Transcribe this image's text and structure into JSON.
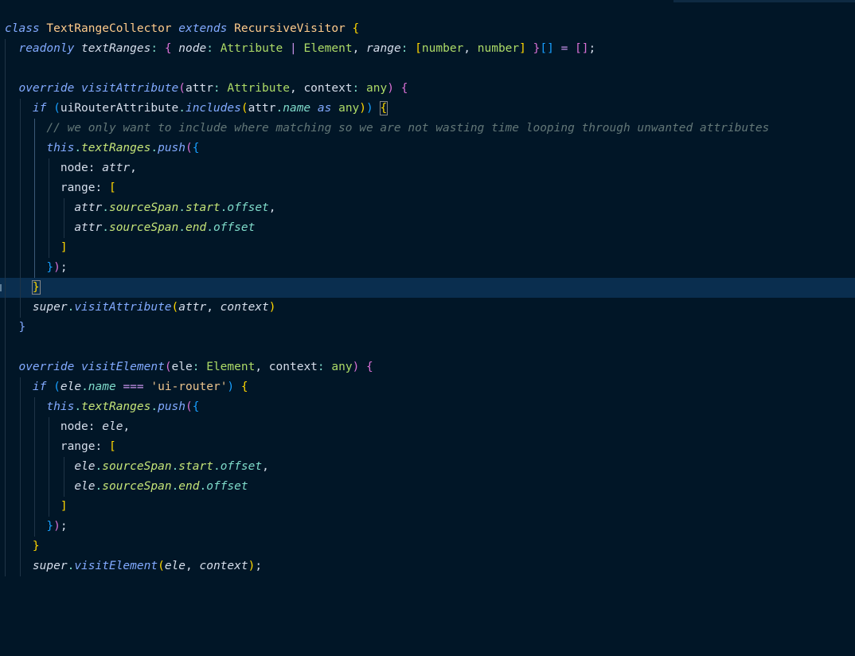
{
  "editor": {
    "language": "TypeScript",
    "theme_colors": {
      "background": "#011627",
      "current_line": "#0a2e4f",
      "keyword": "#82aaff",
      "class_name": "#c792ea",
      "type": "#addb67",
      "string": "#ecc48d",
      "comment": "#637777",
      "bracket_gold": "#ffd700",
      "bracket_orchid": "#da70d6",
      "bracket_blue": "#179fff"
    },
    "tokens": {
      "l1": [
        "class",
        "TextRangeCollector",
        "extends",
        "RecursiveVisitor",
        "{"
      ],
      "l2": [
        "readonly",
        "textRanges",
        ":",
        "{",
        "node",
        ":",
        "Attribute",
        "|",
        "Element",
        ",",
        "range",
        ":",
        "[",
        "number",
        ",",
        "number",
        "]",
        "}",
        "[]",
        "=",
        "[]",
        ";"
      ],
      "l4": [
        "override",
        "visitAttribute",
        "(",
        "attr",
        ":",
        "Attribute",
        ",",
        "context",
        ":",
        "any",
        ")",
        "{"
      ],
      "l5": [
        "if",
        "(",
        "uiRouterAttribute",
        ".",
        "includes",
        "(",
        "attr",
        ".",
        "name",
        "as",
        "any",
        ")",
        ")",
        "{"
      ],
      "l6": [
        "// we only want to include where matching so we are not wasting time looping through unwanted attributes"
      ],
      "l7": [
        "this",
        ".",
        "textRanges",
        ".",
        "push",
        "(",
        "{"
      ],
      "l8": [
        "node",
        ":",
        "attr",
        ","
      ],
      "l9": [
        "range",
        ":",
        "["
      ],
      "l10": [
        "attr",
        ".",
        "sourceSpan",
        ".",
        "start",
        ".",
        "offset",
        ","
      ],
      "l11": [
        "attr",
        ".",
        "sourceSpan",
        ".",
        "end",
        ".",
        "offset"
      ],
      "l12": [
        "]"
      ],
      "l13": [
        "}",
        ")",
        ";"
      ],
      "l14": [
        "}"
      ],
      "l15": [
        "super",
        ".",
        "visitAttribute",
        "(",
        "attr",
        ",",
        "context",
        ")"
      ],
      "l16": [
        "}"
      ],
      "l18": [
        "override",
        "visitElement",
        "(",
        "ele",
        ":",
        "Element",
        ",",
        "context",
        ":",
        "any",
        ")",
        "{"
      ],
      "l19": [
        "if",
        "(",
        "ele",
        ".",
        "name",
        "===",
        "'ui-router'",
        ")",
        "{"
      ],
      "l20": [
        "this",
        ".",
        "textRanges",
        ".",
        "push",
        "(",
        "{"
      ],
      "l21": [
        "node",
        ":",
        "ele",
        ","
      ],
      "l22": [
        "range",
        ":",
        "["
      ],
      "l23": [
        "ele",
        ".",
        "sourceSpan",
        ".",
        "start",
        ".",
        "offset",
        ","
      ],
      "l24": [
        "ele",
        ".",
        "sourceSpan",
        ".",
        "end",
        ".",
        "offset"
      ],
      "l25": [
        "]"
      ],
      "l26": [
        "}",
        ")",
        ";"
      ],
      "l27": [
        "}"
      ],
      "l28": [
        "super",
        ".",
        "visitElement",
        "(",
        "ele",
        ",",
        "context",
        ")",
        ";"
      ]
    }
  }
}
